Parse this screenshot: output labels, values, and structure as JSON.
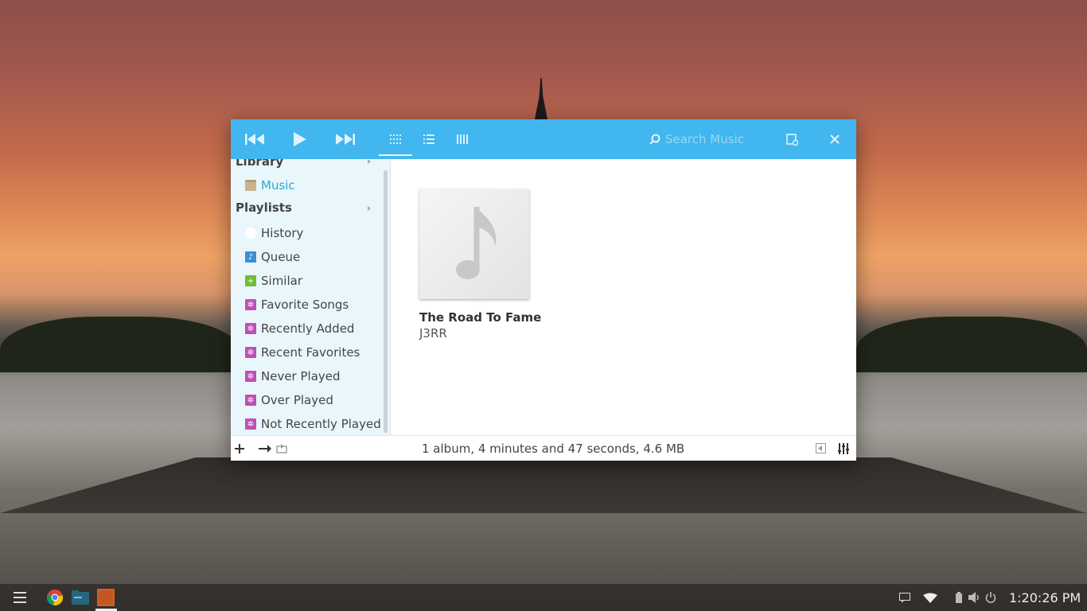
{
  "toolbar": {
    "search_placeholder": "Search Music",
    "accent_color": "#42b6ee"
  },
  "sidebar": {
    "library_header": "Library",
    "playlists_header": "Playlists",
    "library_items": [
      {
        "label": "Music",
        "icon": "folder-icon",
        "active": true
      }
    ],
    "playlist_items": [
      {
        "label": "History",
        "icon": "clock-icon"
      },
      {
        "label": "Queue",
        "icon": "queue-icon"
      },
      {
        "label": "Similar",
        "icon": "similar-icon"
      },
      {
        "label": "Favorite Songs",
        "icon": "smart-playlist-icon"
      },
      {
        "label": "Recently Added",
        "icon": "smart-playlist-icon"
      },
      {
        "label": "Recent Favorites",
        "icon": "smart-playlist-icon"
      },
      {
        "label": "Never Played",
        "icon": "smart-playlist-icon"
      },
      {
        "label": "Over Played",
        "icon": "smart-playlist-icon"
      },
      {
        "label": "Not Recently Played",
        "icon": "smart-playlist-icon"
      }
    ]
  },
  "albums": [
    {
      "title": "The Road To Fame",
      "artist": "J3RR",
      "cover": "music-note-icon"
    }
  ],
  "statusbar": {
    "summary": "1 album, 4 minutes and 47 seconds, 4.6 MB"
  },
  "shelf": {
    "clock": "1:20:26 PM",
    "apps": [
      "app-launcher-icon",
      "chrome-icon",
      "files-icon",
      "music-app-icon"
    ]
  }
}
